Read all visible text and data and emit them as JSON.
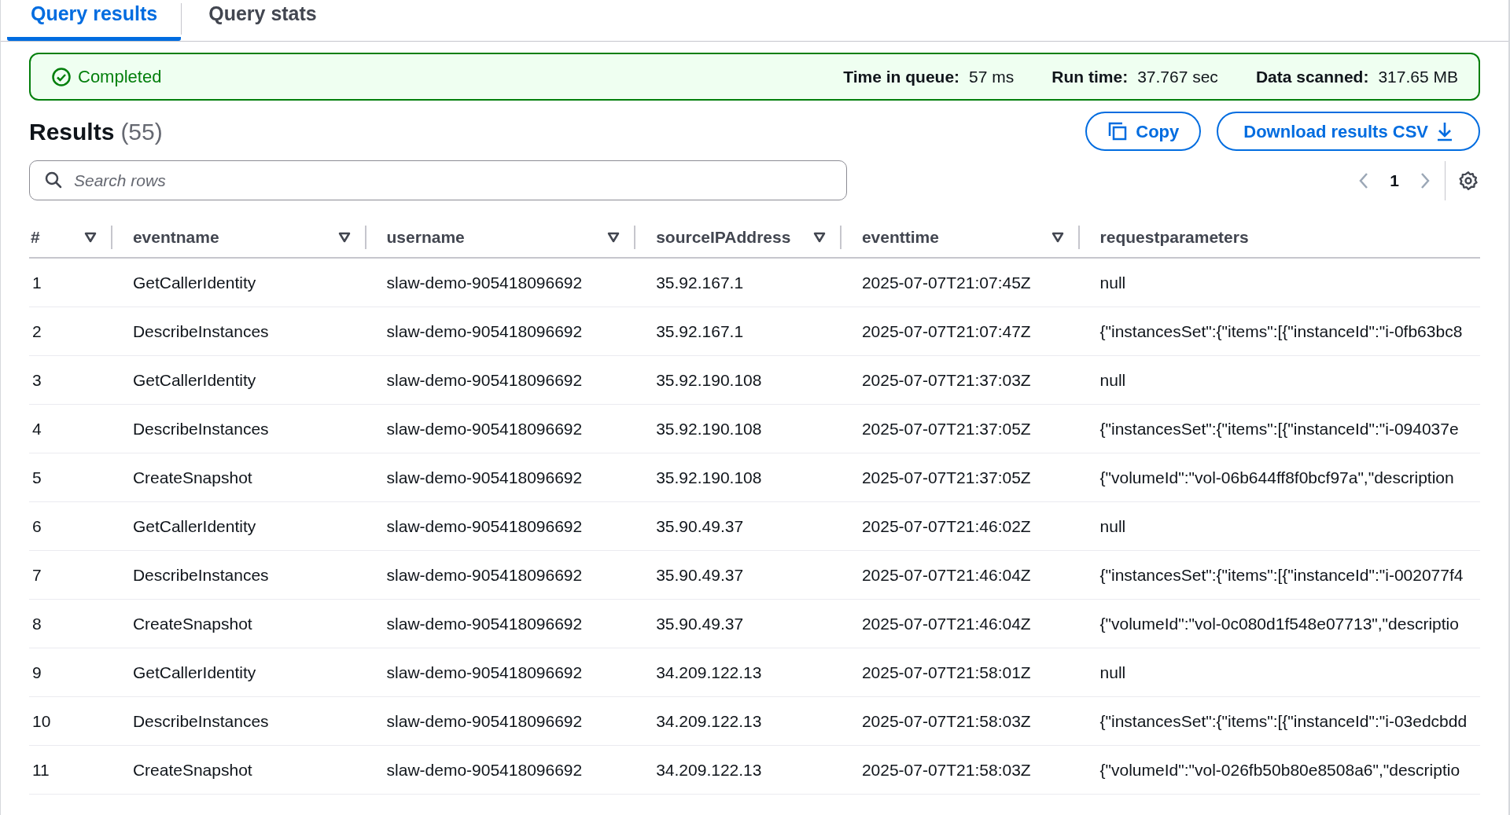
{
  "tabs": [
    {
      "label": "Query results",
      "selected": true
    },
    {
      "label": "Query stats",
      "selected": false
    }
  ],
  "status": {
    "label": "Completed",
    "stats": [
      {
        "label": "Time in queue:",
        "value": "57 ms"
      },
      {
        "label": "Run time:",
        "value": "37.767 sec"
      },
      {
        "label": "Data scanned:",
        "value": "317.65 MB"
      }
    ]
  },
  "results": {
    "title": "Results",
    "count": "(55)",
    "buttons": [
      {
        "kind": "copy",
        "label": "Copy"
      },
      {
        "kind": "download",
        "label": "Download results CSV"
      }
    ]
  },
  "search": {
    "placeholder": "Search rows"
  },
  "pagination": {
    "page": "1"
  },
  "table": {
    "columns": [
      {
        "label": "#",
        "sortable": true
      },
      {
        "label": "eventname",
        "sortable": true
      },
      {
        "label": "username",
        "sortable": true
      },
      {
        "label": "sourceIPAddress",
        "sortable": true
      },
      {
        "label": "eventtime",
        "sortable": true
      },
      {
        "label": "requestparameters",
        "sortable": false
      }
    ],
    "rows": [
      [
        "1",
        "GetCallerIdentity",
        "slaw-demo-905418096692",
        "35.92.167.1",
        "2025-07-07T21:07:45Z",
        "null"
      ],
      [
        "2",
        "DescribeInstances",
        "slaw-demo-905418096692",
        "35.92.167.1",
        "2025-07-07T21:07:47Z",
        "{\"instancesSet\":{\"items\":[{\"instanceId\":\"i-0fb63bc8"
      ],
      [
        "3",
        "GetCallerIdentity",
        "slaw-demo-905418096692",
        "35.92.190.108",
        "2025-07-07T21:37:03Z",
        "null"
      ],
      [
        "4",
        "DescribeInstances",
        "slaw-demo-905418096692",
        "35.92.190.108",
        "2025-07-07T21:37:05Z",
        "{\"instancesSet\":{\"items\":[{\"instanceId\":\"i-094037e"
      ],
      [
        "5",
        "CreateSnapshot",
        "slaw-demo-905418096692",
        "35.92.190.108",
        "2025-07-07T21:37:05Z",
        "{\"volumeId\":\"vol-06b644ff8f0bcf97a\",\"description"
      ],
      [
        "6",
        "GetCallerIdentity",
        "slaw-demo-905418096692",
        "35.90.49.37",
        "2025-07-07T21:46:02Z",
        "null"
      ],
      [
        "7",
        "DescribeInstances",
        "slaw-demo-905418096692",
        "35.90.49.37",
        "2025-07-07T21:46:04Z",
        "{\"instancesSet\":{\"items\":[{\"instanceId\":\"i-002077f4"
      ],
      [
        "8",
        "CreateSnapshot",
        "slaw-demo-905418096692",
        "35.90.49.37",
        "2025-07-07T21:46:04Z",
        "{\"volumeId\":\"vol-0c080d1f548e07713\",\"descriptio"
      ],
      [
        "9",
        "GetCallerIdentity",
        "slaw-demo-905418096692",
        "34.209.122.13",
        "2025-07-07T21:58:01Z",
        "null"
      ],
      [
        "10",
        "DescribeInstances",
        "slaw-demo-905418096692",
        "34.209.122.13",
        "2025-07-07T21:58:03Z",
        "{\"instancesSet\":{\"items\":[{\"instanceId\":\"i-03edcbdd"
      ],
      [
        "11",
        "CreateSnapshot",
        "slaw-demo-905418096692",
        "34.209.122.13",
        "2025-07-07T21:58:03Z",
        "{\"volumeId\":\"vol-026fb50b80e8508a6\",\"descriptio"
      ]
    ]
  }
}
